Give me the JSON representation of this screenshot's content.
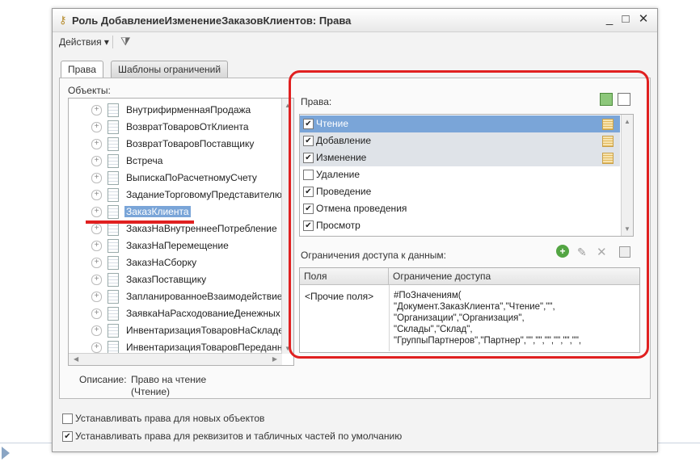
{
  "window": {
    "title": "Роль ДобавлениеИзменениеЗаказовКлиентов: Права",
    "controls": [
      "_",
      "□",
      "✕"
    ]
  },
  "toolbar": {
    "actions_label": "Действия ▾",
    "filter_icon": "filter-icon"
  },
  "tabs": [
    {
      "label": "Права"
    },
    {
      "label": "Шаблоны ограничений"
    }
  ],
  "objects": {
    "label": "Объекты:",
    "items": [
      "ВнутрифирменнаяПродажа",
      "ВозвратТоваровОтКлиента",
      "ВозвратТоваровПоставщику",
      "Встреча",
      "ВыпискаПоРасчетномуСчету",
      "ЗаданиеТорговомуПредставителю",
      "ЗаказКлиента",
      "ЗаказНаВнутреннееПотребление",
      "ЗаказНаПеремещение",
      "ЗаказНаСборку",
      "ЗаказПоставщику",
      "ЗапланированноеВзаимодействие",
      "ЗаявкаНаРасходованиеДенежных",
      "ИнвентаризацияТоваровНаСкладе",
      "ИнвентаризацияТоваровПереданных"
    ],
    "selected_index": 6
  },
  "description": {
    "label": "Описание:",
    "line1": "Право на чтение",
    "line2": "(Чтение)"
  },
  "rights": {
    "label": "Права:",
    "items": [
      {
        "label": "Чтение",
        "checked": true,
        "mark": "✔"
      },
      {
        "label": "Добавление",
        "checked": true,
        "mark": "✔"
      },
      {
        "label": "Изменение",
        "checked": true,
        "mark": "✔"
      },
      {
        "label": "Удаление",
        "checked": false,
        "mark": ""
      },
      {
        "label": "Проведение",
        "checked": true,
        "mark": "✔"
      },
      {
        "label": "Отмена проведения",
        "checked": true,
        "mark": "✔"
      },
      {
        "label": "Просмотр",
        "checked": true,
        "mark": "✔"
      }
    ]
  },
  "access": {
    "label": "Ограничения доступа к данным:",
    "col_fields": "Поля",
    "col_restriction": "Ограничение доступа",
    "row_field": "<Прочие поля>",
    "code_lines": [
      "#ПоЗначениям(",
      "\"Документ.ЗаказКлиента\",\"Чтение\",\"\",",
      "\"Организации\",\"Организация\",",
      "\"Склады\",\"Склад\",",
      "\"ГруппыПартнеров\",\"Партнер\",\"\",\"\",\"\",\"\",\"\",\"\","
    ]
  },
  "options": {
    "new_objects": {
      "label": "Устанавливать права для новых объектов",
      "checked": false,
      "mark": ""
    },
    "attributes": {
      "label": "Устанавливать права для реквизитов и табличных частей по умолчанию",
      "checked": true,
      "mark": "✔"
    }
  },
  "colors": {
    "annotation": "#e02020",
    "selection": "#7aa5d8"
  }
}
